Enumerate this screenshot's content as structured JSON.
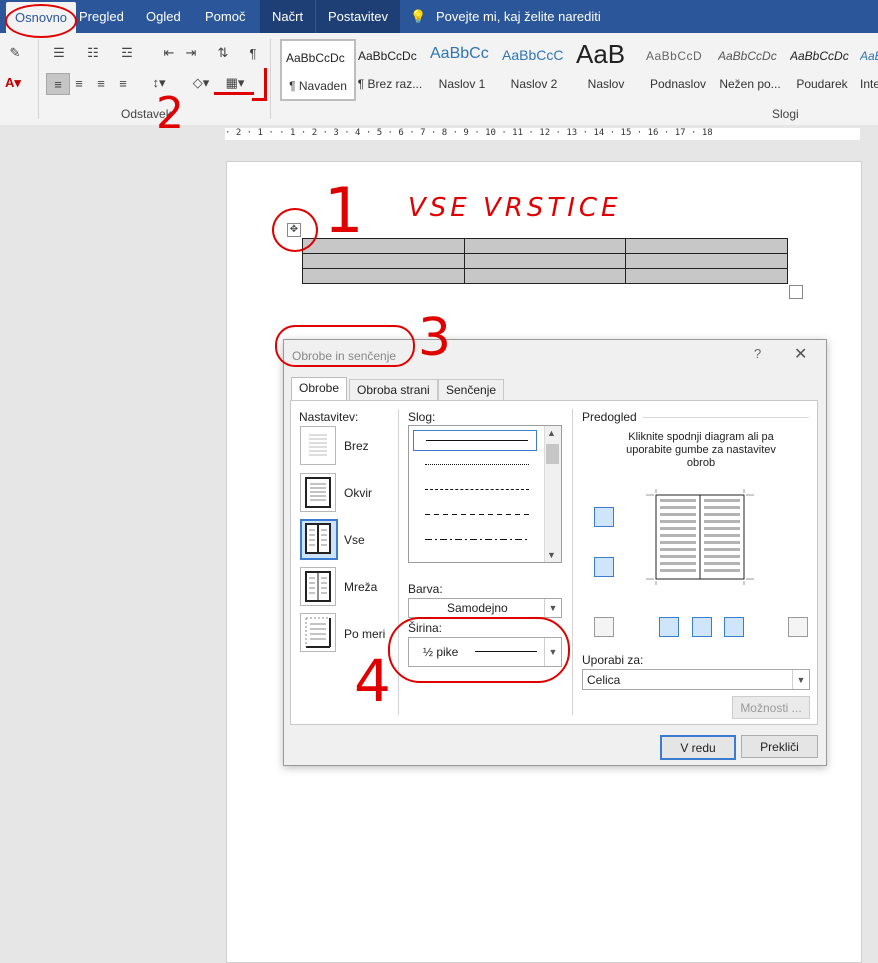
{
  "ribbon_tabs": [
    {
      "label": "Osnovno",
      "active": true
    },
    {
      "label": "Pregled"
    },
    {
      "label": "Ogled"
    },
    {
      "label": "Pomoč"
    },
    {
      "label": "Načrt"
    },
    {
      "label": "Postavitev"
    }
  ],
  "tell_me": "Povejte mi, kaj želite narediti",
  "ribbon": {
    "paragraph_group": "Odstavek",
    "styles_group": "Slogi",
    "pilcrow": "¶"
  },
  "styles": [
    {
      "sample": "AaBbCcDc",
      "name": "¶ Navaden"
    },
    {
      "sample": "AaBbCcDc",
      "name": "¶ Brez raz..."
    },
    {
      "sample": "AaBbCc",
      "name": "Naslov 1"
    },
    {
      "sample": "AaBbCcC",
      "name": "Naslov 2"
    },
    {
      "sample": "AaB",
      "name": "Naslov"
    },
    {
      "sample": "AaBbCcD",
      "name": "Podnaslov"
    },
    {
      "sample": "AaBbCcDc",
      "name": "Nežen po..."
    },
    {
      "sample": "AaBbCcDc",
      "name": "Poudarek"
    },
    {
      "sample": "AaBb",
      "name": "Inte"
    }
  ],
  "ruler_text": "· 2 · 1 · · 1 · 2 · 3 · 4 · 5 · 6 · 7 · 8 · 9 · 10 · 11 · 12 · 13 · 14 · 15 · 16 · 17 · 18",
  "dialog": {
    "title": "Obrobe in senčenje",
    "help": "?",
    "close": "✕",
    "tabs": [
      {
        "label": "Obrobe",
        "active": true
      },
      {
        "label": "Obroba strani"
      },
      {
        "label": "Senčenje"
      }
    ],
    "setting_heading": "Nastavitev:",
    "settings": [
      {
        "label": "Brez"
      },
      {
        "label": "Okvir"
      },
      {
        "label": "Vse",
        "selected": true
      },
      {
        "label": "Mreža"
      },
      {
        "label": "Po meri"
      }
    ],
    "style_heading": "Slog:",
    "color_heading": "Barva:",
    "color_value": "Samodejno",
    "width_heading": "Širina:",
    "width_value": "½ pike",
    "preview_heading": "Predogled",
    "preview_hint": "Kliknite spodnji diagram ali pa uporabite gumbe za nastavitev obrob",
    "apply_heading": "Uporabi za:",
    "apply_value": "Celica",
    "options_button": "Možnosti ...",
    "ok_button": "V redu",
    "cancel_button": "Prekliči"
  },
  "annotations": {
    "one": "1",
    "two": "2",
    "three": "3",
    "four": "4",
    "vse_vrstice": "VSE VRSTICE"
  },
  "colors": {
    "word_blue": "#2b579a",
    "annotation_red": "#e00000",
    "selection_blue": "#3b7bd0"
  }
}
